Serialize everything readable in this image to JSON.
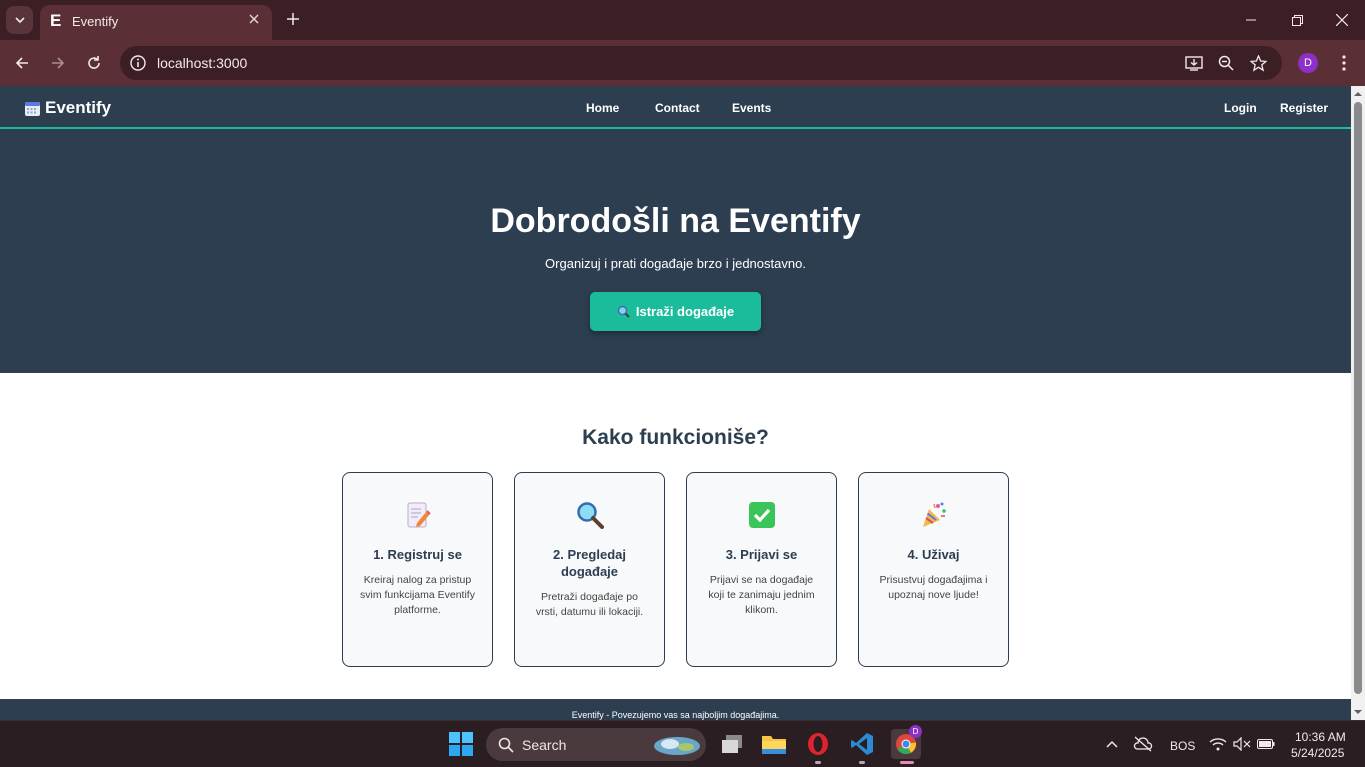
{
  "browser": {
    "tab_title": "Eventify",
    "tab_favicon_letter": "E",
    "url": "localhost:3000",
    "profile_initial": "D"
  },
  "site": {
    "brand": "Eventify",
    "nav_center": [
      "Home",
      "Contact",
      "Events"
    ],
    "nav_right": [
      "Login",
      "Register"
    ]
  },
  "hero": {
    "title": "Dobrodošli na Eventify",
    "subtitle": "Organizuj i prati događaje brzo i jednostavno.",
    "button_label": "Istraži događaje"
  },
  "how": {
    "title": "Kako funkcioniše?",
    "cards": [
      {
        "icon": "memo-icon",
        "title": "1. Registruj se",
        "text": "Kreiraj nalog za pristup svim funkcijama Eventify platforme."
      },
      {
        "icon": "magnifier-icon",
        "title": "2. Pregledaj događaje",
        "text": "Pretraži događaje po vrsti, datumu ili lokaciji."
      },
      {
        "icon": "check-mark-icon",
        "title": "3. Prijavi se",
        "text": "Prijavi se na događaje koji te zanimaju jednim klikom."
      },
      {
        "icon": "party-popper-icon",
        "title": "4. Uživaj",
        "text": "Prisustvuj događajima i upoznaj nove ljude!"
      }
    ]
  },
  "footer": {
    "text": "Eventify - Povezujemo vas sa najboljim događajima."
  },
  "taskbar": {
    "search_label": "Search",
    "language": "BOS",
    "time": "10:36 AM",
    "date": "5/24/2025",
    "profile_badge": "D"
  },
  "colors": {
    "nav_bg": "#2c3e50",
    "accent": "#1abc9c",
    "browser_frame": "#5a2f36"
  }
}
